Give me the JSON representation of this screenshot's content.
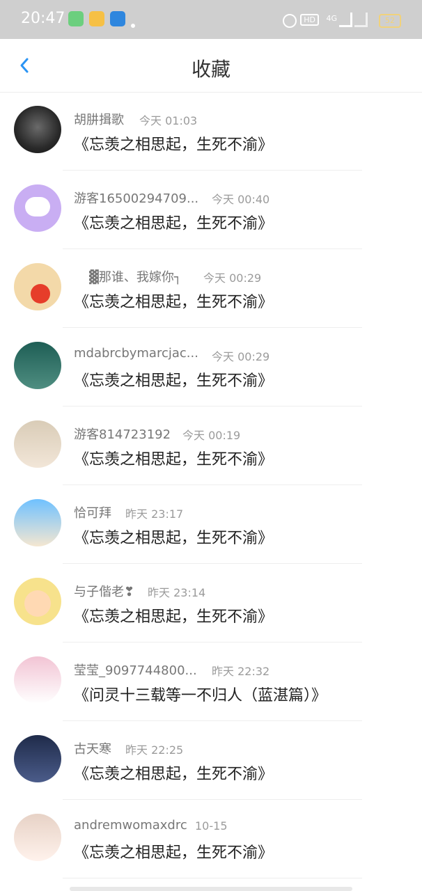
{
  "status_bar": {
    "time": "20:47",
    "hd_label": "HD",
    "network": "4G",
    "battery": "52"
  },
  "nav": {
    "title": "收藏"
  },
  "items": [
    {
      "name": "胡肼揖歌",
      "time": "今天 01:03",
      "content": "《忘羡之相思起，生死不渝》"
    },
    {
      "name": "游客16500294709...",
      "time": "今天 00:40",
      "content": "《忘羡之相思起，生死不渝》"
    },
    {
      "name": "▓那谁、我嫁你┐",
      "time": "今天 00:29",
      "content": "《忘羡之相思起，生死不渝》"
    },
    {
      "name": "mdabrcbymarcjac...",
      "time": "今天 00:29",
      "content": "《忘羡之相思起，生死不渝》"
    },
    {
      "name": "游客814723192",
      "time": "今天 00:19",
      "content": "《忘羡之相思起，生死不渝》"
    },
    {
      "name": "恰可拜",
      "time": "昨天 23:17",
      "content": "《忘羡之相思起，生死不渝》"
    },
    {
      "name": "与子偕老❣",
      "time": "昨天 23:14",
      "content": "《忘羡之相思起，生死不渝》"
    },
    {
      "name": "莹莹_9097744800...",
      "time": "昨天 22:32",
      "content": "《问灵十三载等一不归人（蓝湛篇）》"
    },
    {
      "name": "古天寒",
      "time": "昨天 22:25",
      "content": "《忘羡之相思起，生死不渝》"
    },
    {
      "name": "andremwomaxdrc",
      "time": "10-15",
      "content": "《忘羡之相思起，生死不渝》"
    }
  ]
}
